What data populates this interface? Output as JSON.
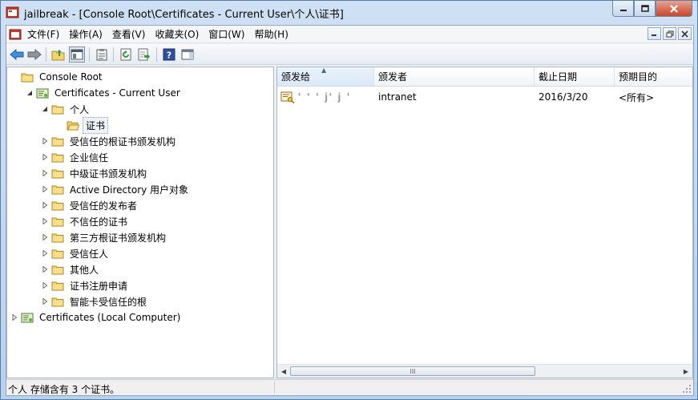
{
  "window": {
    "title": "jailbreak - [Console Root\\Certificates - Current User\\个人\\证书]",
    "caption_buttons": [
      "minimize-icon",
      "maximize-icon",
      "close-icon"
    ]
  },
  "menubar": {
    "items": [
      "文件(F)",
      "操作(A)",
      "查看(V)",
      "收藏夹(O)",
      "窗口(W)",
      "帮助(H)"
    ],
    "mdi_buttons": [
      "minimize-icon",
      "restore-icon",
      "close-icon"
    ]
  },
  "toolbar": {
    "buttons": [
      "back-icon",
      "forward-icon",
      "up-folder-icon",
      "show-hide-tree-icon",
      "properties-icon",
      "refresh-icon",
      "export-list-icon",
      "help-icon",
      "action-pane-icon"
    ]
  },
  "tree": {
    "items": [
      {
        "label": "Console Root",
        "level": 0,
        "expander": "none",
        "icon": "folder"
      },
      {
        "label": "Certificates - Current User",
        "level": 1,
        "expander": "expanded",
        "icon": "cert-store"
      },
      {
        "label": "个人",
        "level": 2,
        "expander": "expanded",
        "icon": "folder"
      },
      {
        "label": "证书",
        "level": 3,
        "expander": "none",
        "icon": "folder-open",
        "selected": true
      },
      {
        "label": "受信任的根证书颁发机构",
        "level": 2,
        "expander": "collapsed",
        "icon": "folder"
      },
      {
        "label": "企业信任",
        "level": 2,
        "expander": "collapsed",
        "icon": "folder"
      },
      {
        "label": "中级证书颁发机构",
        "level": 2,
        "expander": "collapsed",
        "icon": "folder"
      },
      {
        "label": "Active Directory 用户对象",
        "level": 2,
        "expander": "collapsed",
        "icon": "folder"
      },
      {
        "label": "受信任的发布者",
        "level": 2,
        "expander": "collapsed",
        "icon": "folder"
      },
      {
        "label": "不信任的证书",
        "level": 2,
        "expander": "collapsed",
        "icon": "folder"
      },
      {
        "label": "第三方根证书颁发机构",
        "level": 2,
        "expander": "collapsed",
        "icon": "folder"
      },
      {
        "label": "受信任人",
        "level": 2,
        "expander": "collapsed",
        "icon": "folder"
      },
      {
        "label": "其他人",
        "level": 2,
        "expander": "collapsed",
        "icon": "folder"
      },
      {
        "label": "证书注册申请",
        "level": 2,
        "expander": "collapsed",
        "icon": "folder"
      },
      {
        "label": "智能卡受信任的根",
        "level": 2,
        "expander": "collapsed",
        "icon": "folder"
      },
      {
        "label": "Certificates (Local Computer)",
        "level": 0,
        "expander": "collapsed",
        "icon": "cert-store"
      }
    ]
  },
  "list": {
    "columns": [
      "颁发给",
      "颁发者",
      "截止日期",
      "预期目的"
    ],
    "sorted_column": "颁发给",
    "rows": [
      {
        "issued_to": "'  '  ' j'  j  '",
        "issued_by": "intranet",
        "expiration": "2016/3/20",
        "purposes": "<所有>"
      }
    ],
    "scroll_grip": "III"
  },
  "status": {
    "text": "个人 存储含有 3 个证书。"
  },
  "colors": {
    "folder_yellow": "#f3d36b",
    "frame_blue": "#b9d1ee",
    "close_red": "#c7452b"
  }
}
